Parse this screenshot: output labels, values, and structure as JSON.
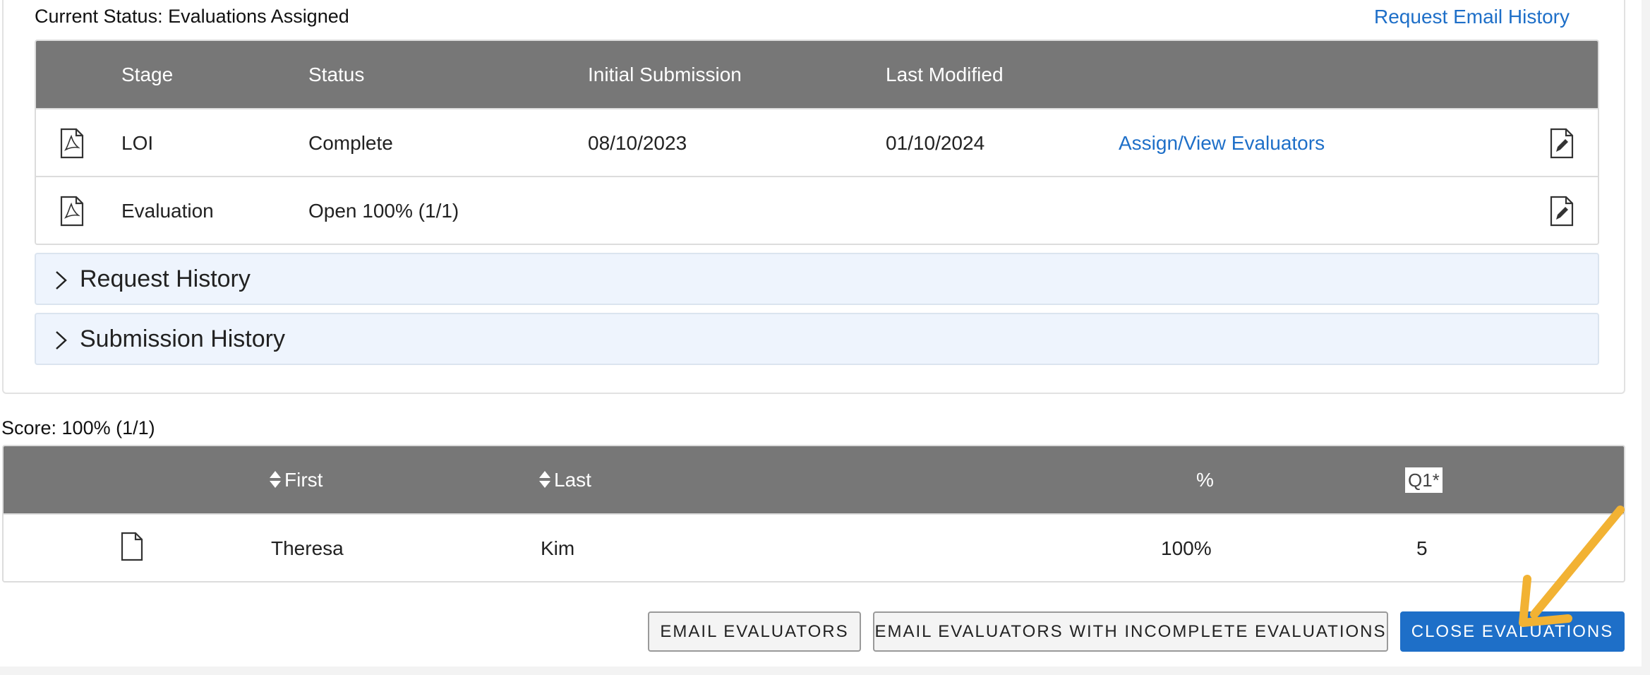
{
  "header": {
    "current_status": "Current Status: Evaluations Assigned",
    "request_email_history": "Request Email History"
  },
  "stages": {
    "columns": [
      "Stage",
      "Status",
      "Initial Submission",
      "Last Modified"
    ],
    "rows": [
      {
        "stage": "LOI",
        "status": "Complete",
        "initial_submission": "08/10/2023",
        "last_modified": "01/10/2024",
        "action": "Assign/View Evaluators"
      },
      {
        "stage": "Evaluation",
        "status": "Open 100% (1/1)",
        "initial_submission": "",
        "last_modified": "",
        "action": ""
      }
    ]
  },
  "accordions": {
    "request_history": "Request History",
    "submission_history": "Submission History"
  },
  "score": {
    "label": "Score: 100% (1/1)",
    "columns": {
      "first": "First",
      "last": "Last",
      "percent": "%",
      "q1": "Q1*"
    },
    "rows": [
      {
        "first": "Theresa",
        "last": "Kim",
        "percent": "100%",
        "q1": "5"
      }
    ]
  },
  "buttons": {
    "email_evaluators": "EMAIL EVALUATORS",
    "email_incomplete": "EMAIL EVALUATORS WITH INCOMPLETE EVALUATIONS",
    "close_evaluations": "CLOSE EVALUATIONS"
  },
  "colors": {
    "header_bg": "#777777",
    "link": "#1e6fc8",
    "primary_button": "#1e6fc8",
    "accordion_bg": "#eef4fd",
    "annotation_arrow": "#f2b233"
  },
  "icons": {
    "stage_file": "pdf-file-icon",
    "edit": "edit-document-icon",
    "accordion": "chevron-right-icon",
    "sort": "sort-icon",
    "evaluation_doc": "document-icon"
  }
}
